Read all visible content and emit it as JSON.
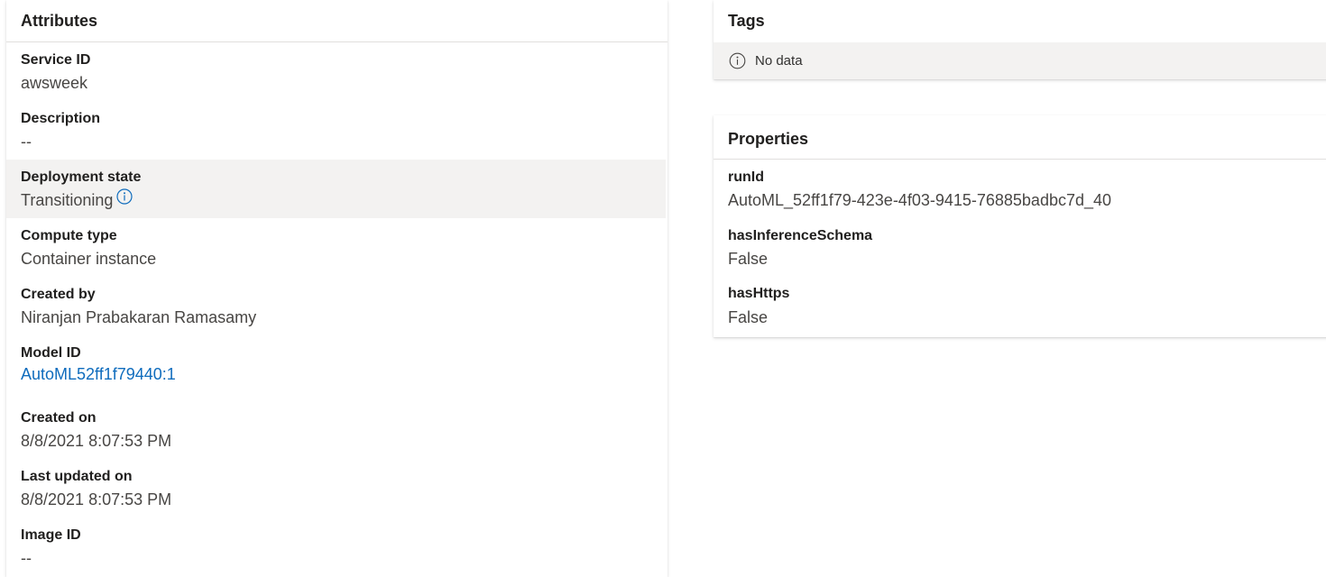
{
  "attributes": {
    "title": "Attributes",
    "fields": {
      "service_id": {
        "label": "Service ID",
        "value": "awsweek"
      },
      "description": {
        "label": "Description",
        "value": "--"
      },
      "deployment_state": {
        "label": "Deployment state",
        "value": "Transitioning",
        "icon": "info-icon"
      },
      "compute_type": {
        "label": "Compute type",
        "value": "Container instance"
      },
      "created_by": {
        "label": "Created by",
        "value": "Niranjan Prabakaran Ramasamy"
      },
      "model_id": {
        "label": "Model ID",
        "value": "AutoML52ff1f79440:1"
      },
      "created_on": {
        "label": "Created on",
        "value": "8/8/2021 8:07:53 PM"
      },
      "last_updated_on": {
        "label": "Last updated on",
        "value": "8/8/2021 8:07:53 PM"
      },
      "image_id": {
        "label": "Image ID",
        "value": "--"
      }
    }
  },
  "tags": {
    "title": "Tags",
    "empty_text": "No data",
    "empty_icon": "info-icon"
  },
  "properties": {
    "title": "Properties",
    "fields": {
      "run_id": {
        "label": "runId",
        "value": "AutoML_52ff1f79-423e-4f03-9415-76885badbc7d_40"
      },
      "has_inference_schema": {
        "label": "hasInferenceSchema",
        "value": "False"
      },
      "has_https": {
        "label": "hasHttps",
        "value": "False"
      }
    }
  },
  "colors": {
    "link": "#0f6cbd",
    "highlight_row": "#f3f2f1",
    "label_text": "#201f1e",
    "value_text": "#484644"
  }
}
